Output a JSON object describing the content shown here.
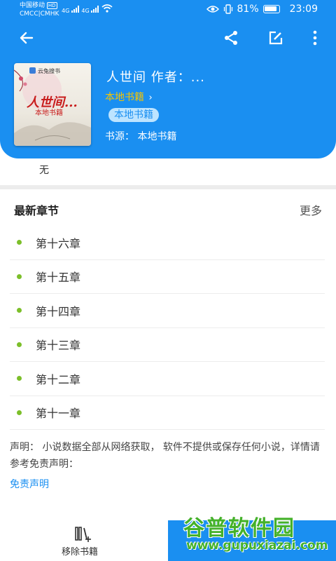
{
  "status_bar": {
    "carrier_line1": "中国移动",
    "hd_badge": "HD",
    "carrier_line2": "CMCC|CMHK",
    "signal1": "4G",
    "signal2": "4G",
    "battery_percent": "81%",
    "time": "23:09"
  },
  "toolbar": {
    "back_icon": "arrow-left-icon",
    "share_icon": "share-icon",
    "edit_icon": "edit-icon",
    "more_icon": "more-vertical-icon"
  },
  "book": {
    "cover_brand": "云兔搜书",
    "cover_title": "人世间...",
    "cover_subtitle": "本地书籍",
    "title": "人世间 作者：...",
    "author_link": "本地书籍",
    "tag": "本地书籍",
    "source": "书源： 本地书籍",
    "intro": "无"
  },
  "latest": {
    "title": "最新章节",
    "more": "更多",
    "chapters": [
      "第十六章",
      "第十五章",
      "第十四章",
      "第十三章",
      "第十二章",
      "第十一章"
    ]
  },
  "disclaimer": {
    "text": "声明： 小说数据全部从网络获取， 软件不提供或保存任何小说，详情请参考免责声明：",
    "link": "免责声明"
  },
  "bottom": {
    "remove_label": "移除书籍"
  },
  "watermark": {
    "line1": "谷普软件园",
    "line2": "www.gupuxiazai.com"
  },
  "colors": {
    "primary": "#1a8ff1",
    "accent_author": "#f5c400",
    "dot": "#7cbf2a"
  }
}
